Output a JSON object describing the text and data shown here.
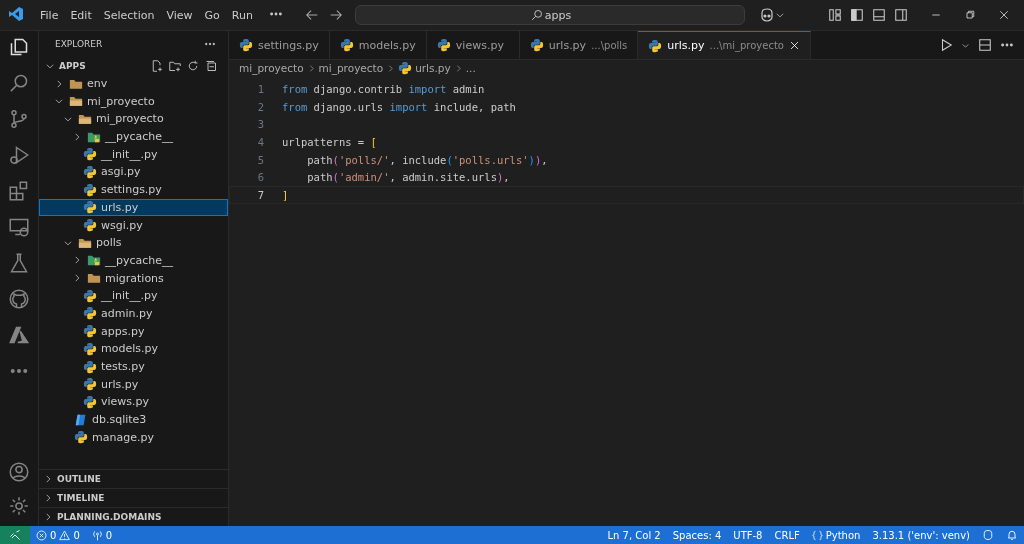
{
  "menu": [
    "File",
    "Edit",
    "Selection",
    "View",
    "Go",
    "Run"
  ],
  "search": {
    "value": "apps"
  },
  "sidebar": {
    "title": "EXPLORER",
    "root": "APPS",
    "expanded": true,
    "tree": [
      {
        "label": "env",
        "kind": "folder",
        "expanded": false,
        "selected": false
      },
      {
        "label": "mi_proyecto",
        "kind": "folder",
        "expanded": true,
        "selected": false,
        "children": [
          {
            "label": "mi_proyecto",
            "kind": "folder",
            "expanded": true,
            "selected": false,
            "children": [
              {
                "label": "__pycache__",
                "kind": "pycache",
                "expanded": false,
                "selected": false
              },
              {
                "label": "__init__.py",
                "kind": "python",
                "selected": false
              },
              {
                "label": "asgi.py",
                "kind": "python",
                "selected": false
              },
              {
                "label": "settings.py",
                "kind": "python",
                "selected": false
              },
              {
                "label": "urls.py",
                "kind": "python",
                "selected": true
              },
              {
                "label": "wsgi.py",
                "kind": "python",
                "selected": false
              }
            ]
          },
          {
            "label": "polls",
            "kind": "folder",
            "expanded": true,
            "selected": false,
            "children": [
              {
                "label": "__pycache__",
                "kind": "pycache",
                "expanded": false,
                "selected": false
              },
              {
                "label": "migrations",
                "kind": "folder",
                "expanded": false,
                "selected": false
              },
              {
                "label": "__init__.py",
                "kind": "python",
                "selected": false
              },
              {
                "label": "admin.py",
                "kind": "python",
                "selected": false
              },
              {
                "label": "apps.py",
                "kind": "python",
                "selected": false
              },
              {
                "label": "models.py",
                "kind": "python",
                "selected": false
              },
              {
                "label": "tests.py",
                "kind": "python",
                "selected": false
              },
              {
                "label": "urls.py",
                "kind": "python",
                "selected": false
              },
              {
                "label": "views.py",
                "kind": "python",
                "selected": false
              }
            ]
          },
          {
            "label": "db.sqlite3",
            "kind": "db",
            "selected": false
          },
          {
            "label": "manage.py",
            "kind": "python",
            "selected": false
          }
        ]
      }
    ],
    "sections": [
      {
        "label": "OUTLINE",
        "expanded": false
      },
      {
        "label": "TIMELINE",
        "expanded": false
      },
      {
        "label": "PLANNING.DOMAINS",
        "expanded": false
      }
    ]
  },
  "tabs": [
    {
      "label": "settings.py",
      "selected": false
    },
    {
      "label": "models.py",
      "selected": false
    },
    {
      "label": "views.py",
      "selected": false
    },
    {
      "label": "urls.py",
      "description": "...\\polls",
      "selected": false
    },
    {
      "label": "urls.py",
      "description": "...\\mi_proyecto",
      "selected": true
    }
  ],
  "breadcrumb": [
    "mi_proyecto",
    "mi_proyecto",
    "urls.py",
    "..."
  ],
  "code": [
    {
      "number": "1",
      "tokens": [
        {
          "kind": "keyword",
          "text": "from"
        },
        {
          "kind": "plain",
          "text": " django.contrib "
        },
        {
          "kind": "keyword",
          "text": "import"
        },
        {
          "kind": "plain",
          "text": " admin"
        }
      ]
    },
    {
      "number": "2",
      "tokens": [
        {
          "kind": "keyword",
          "text": "from"
        },
        {
          "kind": "plain",
          "text": " django.urls "
        },
        {
          "kind": "keyword",
          "text": "import"
        },
        {
          "kind": "plain",
          "text": " include, path"
        }
      ]
    },
    {
      "number": "3"
    },
    {
      "number": "4",
      "tokens": [
        {
          "kind": "plain",
          "text": "urlpatterns = "
        },
        {
          "kind": "bracket1",
          "text": "["
        }
      ]
    },
    {
      "number": "5",
      "tokens": [
        {
          "kind": "plain",
          "text": "    path"
        },
        {
          "kind": "bracket2",
          "text": "("
        },
        {
          "kind": "string",
          "text": "'polls/'"
        },
        {
          "kind": "plain",
          "text": ", include"
        },
        {
          "kind": "bracket3",
          "text": "("
        },
        {
          "kind": "string",
          "text": "'polls.urls'"
        },
        {
          "kind": "bracket3",
          "text": ")"
        },
        {
          "kind": "bracket2",
          "text": ")"
        },
        {
          "kind": "plain",
          "text": ","
        }
      ]
    },
    {
      "number": "6",
      "tokens": [
        {
          "kind": "plain",
          "text": "    path"
        },
        {
          "kind": "bracket2",
          "text": "("
        },
        {
          "kind": "string",
          "text": "'admin/'"
        },
        {
          "kind": "plain",
          "text": ", admin.site.urls"
        },
        {
          "kind": "bracket2",
          "text": ")"
        },
        {
          "kind": "plain",
          "text": ","
        }
      ]
    },
    {
      "number": "7",
      "tokens": [
        {
          "kind": "bracket1",
          "text": "]"
        }
      ],
      "selected": true
    }
  ],
  "status": {
    "errors": "0",
    "warnings": "0",
    "ports": "0",
    "right": [
      "Ln 7, Col 2",
      "Spaces: 4",
      "UTF-8",
      "CRLF",
      "Python",
      "3.13.1 ('env': venv)"
    ]
  }
}
